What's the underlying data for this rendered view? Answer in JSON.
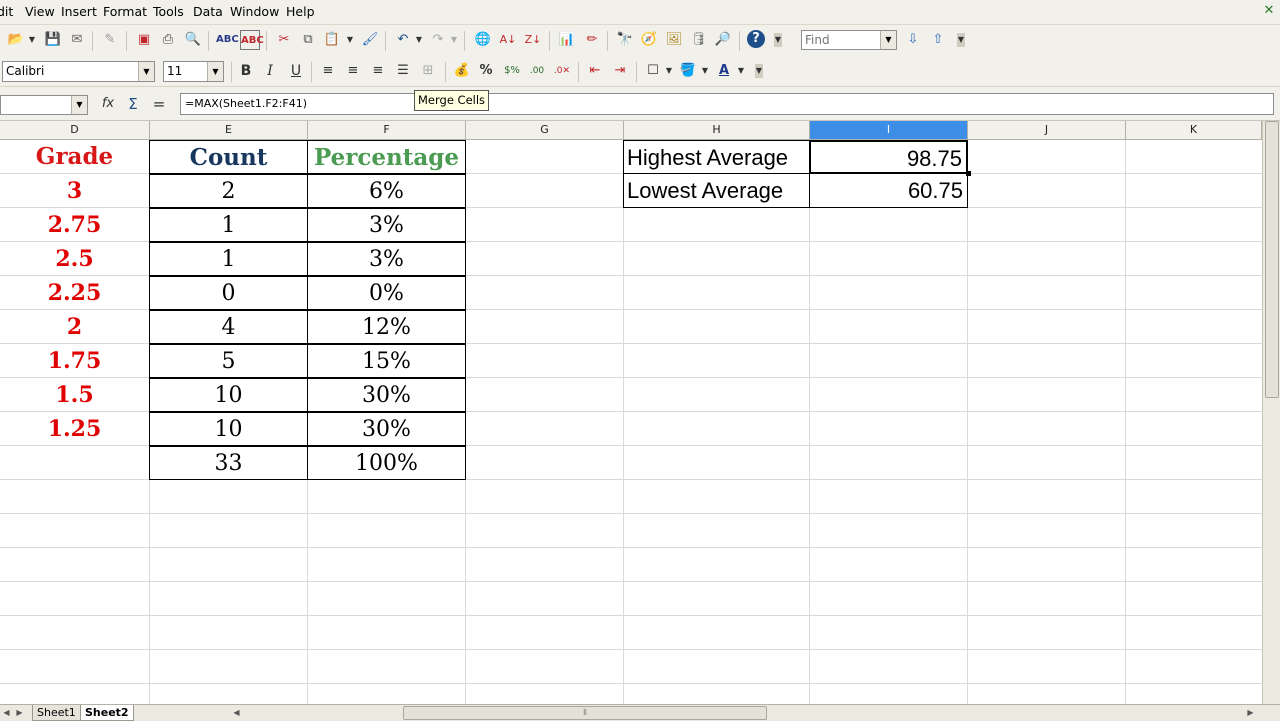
{
  "menu": [
    "dit",
    "View",
    "Insert",
    "Format",
    "Tools",
    "Data",
    "Window",
    "Help"
  ],
  "toolbar": {
    "find_placeholder": "Find",
    "font_name": "Calibri",
    "font_size": "11",
    "bold": "B",
    "italic": "I",
    "underline": "U",
    "percent": "%",
    "help": "?"
  },
  "formula_bar": {
    "name_box": "",
    "content": "=MAX(Sheet1.F2:F41)"
  },
  "tooltip": "Merge Cells",
  "columns": [
    {
      "letter": "D",
      "selected": false
    },
    {
      "letter": "E",
      "selected": false
    },
    {
      "letter": "F",
      "selected": false
    },
    {
      "letter": "G",
      "selected": false
    },
    {
      "letter": "H",
      "selected": false
    },
    {
      "letter": "I",
      "selected": true
    },
    {
      "letter": "J",
      "selected": false
    },
    {
      "letter": "K",
      "selected": false
    }
  ],
  "table": {
    "headers": {
      "grade": "Grade",
      "count": "Count",
      "percentage": "Percentage"
    },
    "rows": [
      {
        "grade": "3",
        "count": "2",
        "percentage": "6%"
      },
      {
        "grade": "2.75",
        "count": "1",
        "percentage": "3%"
      },
      {
        "grade": "2.5",
        "count": "1",
        "percentage": "3%"
      },
      {
        "grade": "2.25",
        "count": "0",
        "percentage": "0%"
      },
      {
        "grade": "2",
        "count": "4",
        "percentage": "12%"
      },
      {
        "grade": "1.75",
        "count": "5",
        "percentage": "15%"
      },
      {
        "grade": "1.5",
        "count": "10",
        "percentage": "30%"
      },
      {
        "grade": "1.25",
        "count": "10",
        "percentage": "30%"
      }
    ],
    "total": {
      "count": "33",
      "percentage": "100%"
    }
  },
  "summary": {
    "highest_label": "Highest Average",
    "highest_value": "98.75",
    "lowest_label": "Lowest Average",
    "lowest_value": "60.75"
  },
  "sheets": [
    {
      "name": "Sheet1",
      "active": false
    },
    {
      "name": "Sheet2",
      "active": true
    }
  ],
  "colors": {
    "grade_red": "#e00000",
    "count_navy": "#17375e",
    "percentage_green": "#4b9b52",
    "selection_blue": "#3d8ee6"
  }
}
